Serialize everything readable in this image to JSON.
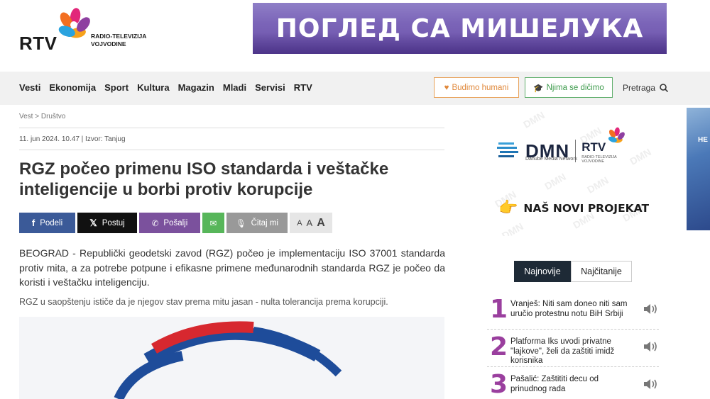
{
  "header": {
    "logo_text": "RTV",
    "logo_subtitle_1": "RADIO-TELEVIZIJA",
    "logo_subtitle_2": "VOJVODINE",
    "banner_text": "ПОГЛЕД СА МИШЕЛУКА"
  },
  "nav": {
    "items": [
      {
        "label": "Vesti"
      },
      {
        "label": "Ekonomija"
      },
      {
        "label": "Sport"
      },
      {
        "label": "Kultura"
      },
      {
        "label": "Magazin"
      },
      {
        "label": "Mladi"
      },
      {
        "label": "Servisi"
      },
      {
        "label": "RTV"
      }
    ],
    "btn_humani": "Budimo humani",
    "btn_dicimo": "Njima se dičimo",
    "search_label": "Pretraga"
  },
  "article": {
    "breadcrumb": "Vest > Društvo",
    "meta": "11. jun  2024. 10.47  | Izvor: Tanjug",
    "title": "RGZ počeo primenu ISO standarda i veštačke inteligencije u borbi protiv korupcije",
    "lead": "BEOGRAD - Republički geodetski zavod (RGZ) počeo je implementaciju ISO 37001 standarda protiv mita, a za potrebe potpune i efikasne primene međunarodnih standarda RGZ je počeo da koristi i veštačku inteligenciju.",
    "paragraph": "RGZ u saopštenju ističe da je njegov stav prema mitu jasan - nulta tolerancija prema korupciji."
  },
  "share": {
    "facebook": "Podeli",
    "x": "Postuj",
    "viber": "Pošalji",
    "read": "Čitaj mi",
    "font_small": "A",
    "font_medium": "A",
    "font_large": "A"
  },
  "sidebar": {
    "dmn_word": "DMN",
    "dmn_sub": "Danube Media Network",
    "dmn_rtv": "RTV",
    "dmn_rtv_sub_1": "RADIO-TELEVIZIJA",
    "dmn_rtv_sub_2": "VOJVODINE",
    "dmn_cta": "NAŠ NOVI PROJEKAT",
    "watermark": "DMN",
    "side_ad_text": "НЕ",
    "tabs": [
      {
        "label": "Najnovije",
        "active": true
      },
      {
        "label": "Najčitanije",
        "active": false
      }
    ],
    "news": [
      {
        "num": "1",
        "text": "Vranješ: Niti sam doneo niti sam uručio protestnu notu BiH Srbiji"
      },
      {
        "num": "2",
        "text": "Platforma Iks uvodi privatne \"lajkove\", želi da zaštiti imidž korisnika"
      },
      {
        "num": "3",
        "text": "Pašalić: Zaštititi decu od prinudnog rada"
      }
    ]
  },
  "colors": {
    "brand_purple": "#9a3f9e",
    "facebook": "#3b5a98",
    "viber": "#7b519d",
    "mail": "#57b65a",
    "humani": "#e0883a",
    "dicimo": "#3c9a4b"
  }
}
